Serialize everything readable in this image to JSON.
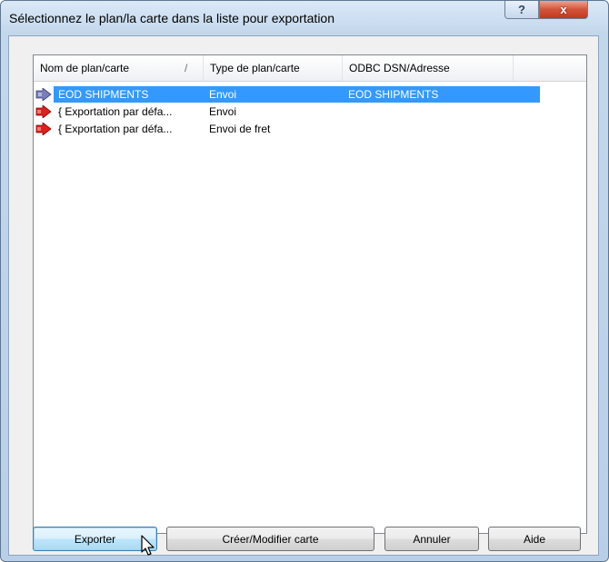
{
  "window": {
    "title": "Sélectionnez le plan/la carte dans la liste pour exportation",
    "help_glyph": "?",
    "close_glyph": "x"
  },
  "list": {
    "columns": [
      {
        "label": "Nom de plan/carte"
      },
      {
        "label": "Type de plan/carte"
      },
      {
        "label": "ODBC DSN/Adresse"
      }
    ],
    "sort_indicator": "/",
    "rows": [
      {
        "name": "EOD SHIPMENTS",
        "type": "Envoi",
        "dsn": "EOD SHIPMENTS",
        "selected": true,
        "icon": "map-export-icon"
      },
      {
        "name": "{ Exportation par défa...",
        "type": "Envoi",
        "dsn": "",
        "selected": false,
        "icon": "map-export-icon"
      },
      {
        "name": "{ Exportation par défa...",
        "type": "Envoi de fret",
        "dsn": "",
        "selected": false,
        "icon": "map-export-icon"
      }
    ]
  },
  "buttons": {
    "export": "Exporter",
    "create_modify": "Créer/Modifier carte",
    "cancel": "Annuler",
    "help": "Aide"
  },
  "colors": {
    "selection": "#3399ff",
    "icon_red": "#e0201b",
    "icon_blue_gray": "#7a7fb8"
  }
}
